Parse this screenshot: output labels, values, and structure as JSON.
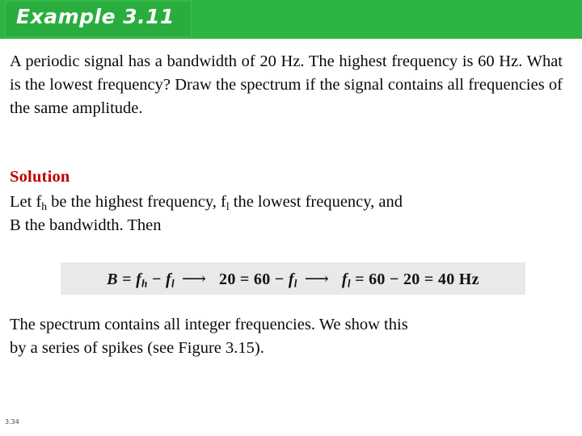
{
  "slide": {
    "header": {
      "title": "Example 3.11",
      "banner_color": "#2db544",
      "banner_inner_color": "#29ad3e",
      "title_color": "#ffffff"
    },
    "intro_paragraph": {
      "line_1": "A periodic signal has a bandwidth of 20 Hz. The highest",
      "line_2": "frequency is 60 Hz. What is the lowest frequency? Draw the",
      "line_3": "spectrum if the signal contains all frequencies of the same",
      "line_4": "amplitude."
    },
    "solution": {
      "heading": "Solution",
      "heading_color": "#c00000",
      "line_1_part_1": "Let f",
      "line_1_sub_1": "h",
      "line_1_part_2": " be the highest frequency, f",
      "line_1_sub_2": "l",
      "line_1_part_3": " the lowest frequency, and",
      "line_2": "B the bandwidth. Then"
    },
    "equation": {
      "background_color": "#e9e9e9",
      "lhs_var": "B",
      "eq_1": " = ",
      "fh_base": "f",
      "fh_sub": "h",
      "minus_1": " − ",
      "fl_base_1": "f",
      "fl_sub_1": "l",
      "arrow_1": "⟶",
      "mid_lhs": "20 = 60 − ",
      "fl_base_2": "f",
      "fl_sub_2": "l",
      "arrow_2": "⟶",
      "rhs_base": "f",
      "rhs_sub": "l",
      "rhs_value": " = 60 − 20 = 40 Hz",
      "plain_text": "B = f_h − f_l ⟶ 20 = 60 − f_l ⟶ f_l = 60 − 20 = 40 Hz"
    },
    "closing_paragraph": {
      "line_1": "The spectrum contains all integer frequencies. We show this",
      "line_2": "by a series of spikes (see Figure 3.15)."
    },
    "footer": {
      "page_number": "3.34"
    }
  }
}
